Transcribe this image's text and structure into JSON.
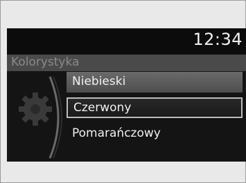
{
  "status_bar": {
    "clock": "12:34"
  },
  "menu": {
    "title": "Kolorystyka",
    "options": [
      {
        "label": "Niebieski",
        "state": "highlighted"
      },
      {
        "label": "Czerwony",
        "state": "selected"
      },
      {
        "label": "Pomarańczowy",
        "state": "normal"
      }
    ]
  },
  "icons": {
    "settings": "gear-icon"
  },
  "colors": {
    "background": "#0c0c0c",
    "title_bar": "#4a4a4a",
    "highlight": "#5c5c5c",
    "selection_border": "#bdbdbd",
    "text": "#f0f0f0"
  }
}
